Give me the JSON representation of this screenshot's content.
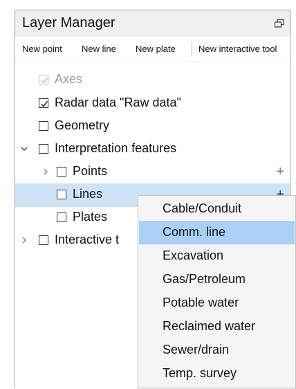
{
  "panel": {
    "title": "Layer Manager",
    "restore_icon": "restore-window-icon"
  },
  "toolbar": {
    "new_point": "New point",
    "new_line": "New line",
    "new_plate": "New plate",
    "new_interactive_tool": "New interactive tool"
  },
  "tree": {
    "axes": {
      "label": "Axes",
      "checked": true,
      "disabled": true
    },
    "radar_data": {
      "label": "Radar data \"Raw data\"",
      "checked": true
    },
    "geometry": {
      "label": "Geometry",
      "checked": false
    },
    "interpretation": {
      "label": "Interpretation features",
      "checked": false,
      "expanded": true
    },
    "points": {
      "label": "Points",
      "checked": false,
      "expanded": false,
      "add": "+"
    },
    "lines": {
      "label": "Lines",
      "checked": false,
      "selected": true,
      "add": "+"
    },
    "plates": {
      "label": "Plates",
      "checked": false
    },
    "interactive": {
      "label": "Interactive t",
      "checked": false,
      "expanded": false
    }
  },
  "menu": {
    "items": [
      "Cable/Conduit",
      "Comm. line",
      "Excavation",
      "Gas/Petroleum",
      "Potable water",
      "Reclaimed water",
      "Sewer/drain",
      "Temp. survey"
    ],
    "highlighted": "Comm. line"
  },
  "colors": {
    "selected_row": "#cfe3f6",
    "menu_highlight": "#a9d1f7",
    "title_bar": "#f0f0f0"
  }
}
